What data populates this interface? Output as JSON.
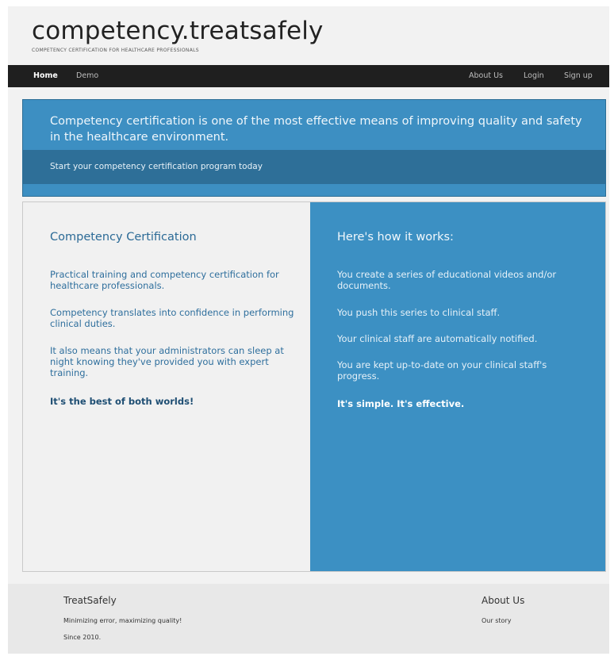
{
  "header": {
    "title": "competency.treatsafely",
    "tagline": "COMPETENCY CERTIFICATION FOR HEALTHCARE PROFESSIONALS"
  },
  "nav": {
    "left": [
      "Home",
      "Demo"
    ],
    "right": [
      "About Us",
      "Login",
      "Sign up"
    ],
    "active": "Home"
  },
  "hero": {
    "title": "Competency certification is one of the most effective means of improving quality and safety in the healthcare environment.",
    "cta": "Start your competency certification program today"
  },
  "left_panel": {
    "title": "Competency Certification",
    "paragraphs": [
      "Practical training and competency certification for healthcare professionals.",
      "Competency translates into confidence in performing clinical duties.",
      "It also means that your administrators can sleep at night knowing they've provided you with expert training."
    ],
    "closing": "It's the best of both worlds!"
  },
  "right_panel": {
    "title": "Here's how it works:",
    "paragraphs": [
      "You create a series of educational videos and/or documents.",
      "You push this series to clinical staff.",
      "Your clinical staff are automatically notified.",
      "You are kept up-to-date on your clinical staff's progress."
    ],
    "closing": "It's simple. It's effective."
  },
  "footer": {
    "brand_title": "TreatSafely",
    "brand_lines": [
      "Minimizing error, maximizing quality!",
      "Since 2010."
    ],
    "about_title": "About Us",
    "about_link": "Our story"
  },
  "colors": {
    "navbar": "#1f1f1f",
    "accent_blue": "#3c90c3",
    "dark_blue_band": "#2e6f98",
    "page_bg": "#f2f2f2"
  }
}
